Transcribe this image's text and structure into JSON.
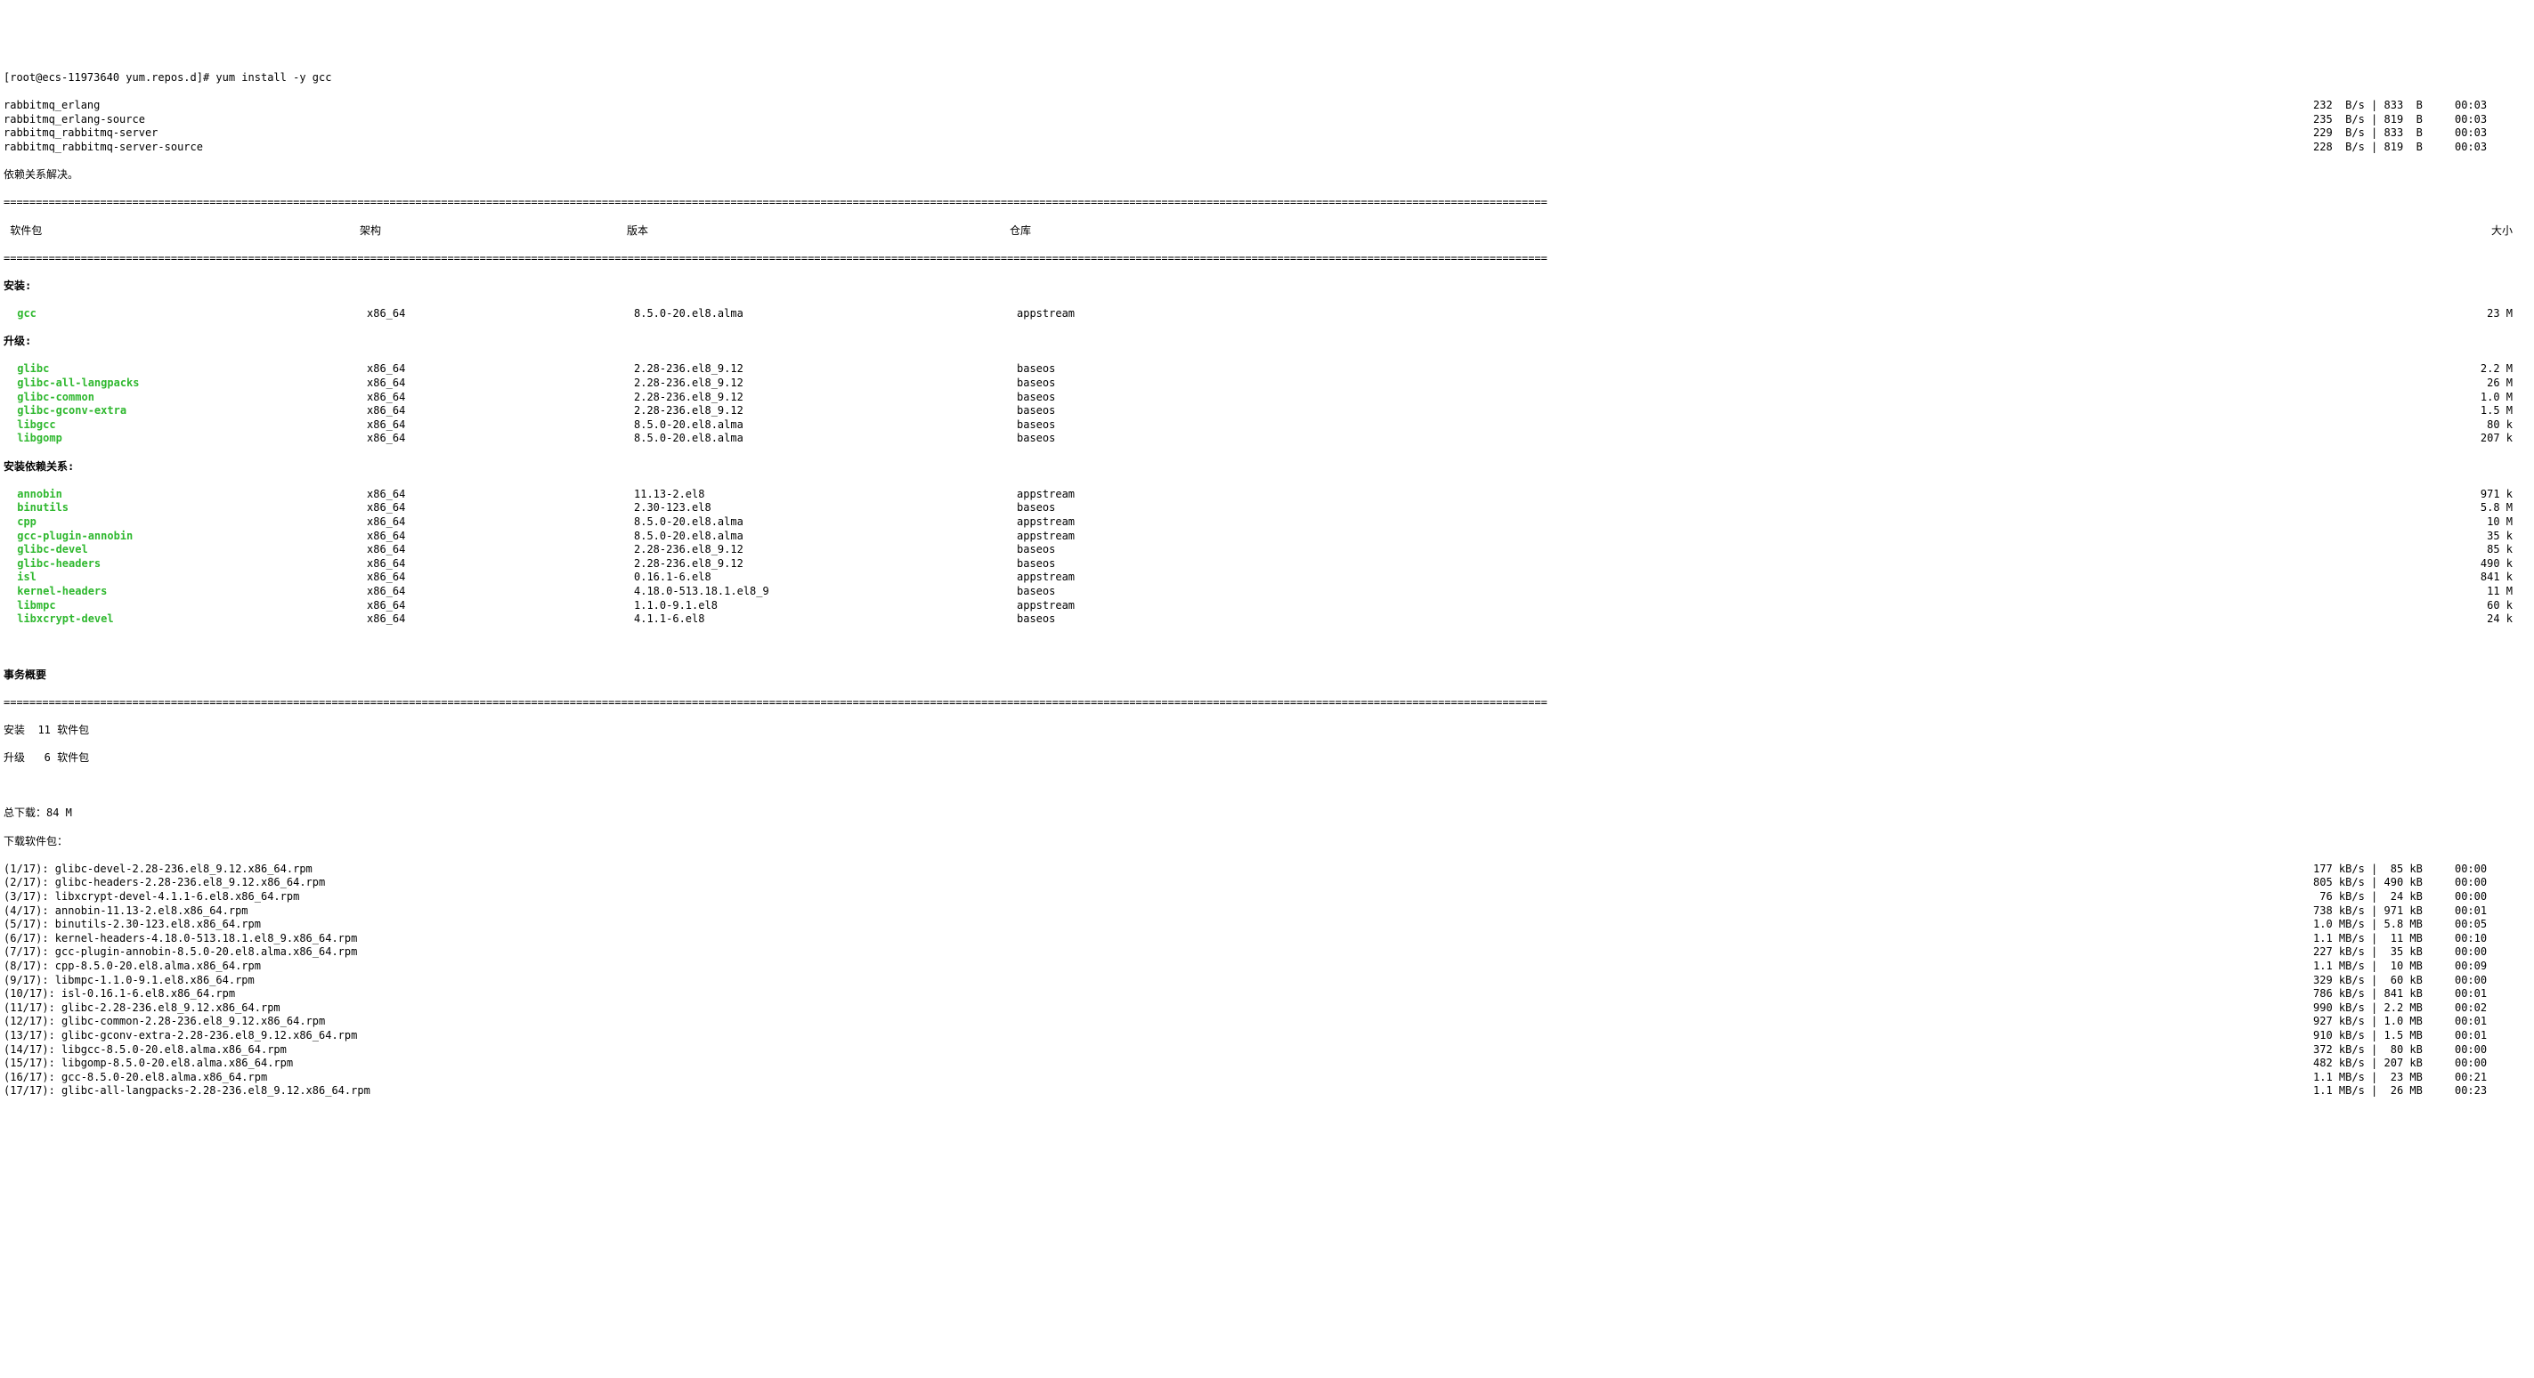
{
  "prompt": "[root@ecs-11973640 yum.repos.d]# yum install -y gcc",
  "repos": [
    {
      "name": "rabbitmq_erlang",
      "speed": "232  B/s",
      "size": "833  B",
      "time": "00:03"
    },
    {
      "name": "rabbitmq_erlang-source",
      "speed": "235  B/s",
      "size": "819  B",
      "time": "00:03"
    },
    {
      "name": "rabbitmq_rabbitmq-server",
      "speed": "229  B/s",
      "size": "833  B",
      "time": "00:03"
    },
    {
      "name": "rabbitmq_rabbitmq-server-source",
      "speed": "228  B/s",
      "size": "819  B",
      "time": "00:03"
    }
  ],
  "deps_resolved": "依赖关系解决。",
  "headers": {
    "pkg": " 软件包",
    "arch": "架构",
    "ver": "版本",
    "repo": "仓库",
    "size": "大小"
  },
  "sections": {
    "install": "安装:",
    "upgrade": "升级:",
    "install_deps": "安装依赖关系:"
  },
  "install": [
    {
      "name": "gcc",
      "arch": "x86_64",
      "ver": "8.5.0-20.el8.alma",
      "repo": "appstream",
      "size": "23 M"
    }
  ],
  "upgrade": [
    {
      "name": "glibc",
      "arch": "x86_64",
      "ver": "2.28-236.el8_9.12",
      "repo": "baseos",
      "size": "2.2 M"
    },
    {
      "name": "glibc-all-langpacks",
      "arch": "x86_64",
      "ver": "2.28-236.el8_9.12",
      "repo": "baseos",
      "size": "26 M"
    },
    {
      "name": "glibc-common",
      "arch": "x86_64",
      "ver": "2.28-236.el8_9.12",
      "repo": "baseos",
      "size": "1.0 M"
    },
    {
      "name": "glibc-gconv-extra",
      "arch": "x86_64",
      "ver": "2.28-236.el8_9.12",
      "repo": "baseos",
      "size": "1.5 M"
    },
    {
      "name": "libgcc",
      "arch": "x86_64",
      "ver": "8.5.0-20.el8.alma",
      "repo": "baseos",
      "size": "80 k"
    },
    {
      "name": "libgomp",
      "arch": "x86_64",
      "ver": "8.5.0-20.el8.alma",
      "repo": "baseos",
      "size": "207 k"
    }
  ],
  "install_deps": [
    {
      "name": "annobin",
      "arch": "x86_64",
      "ver": "11.13-2.el8",
      "repo": "appstream",
      "size": "971 k"
    },
    {
      "name": "binutils",
      "arch": "x86_64",
      "ver": "2.30-123.el8",
      "repo": "baseos",
      "size": "5.8 M"
    },
    {
      "name": "cpp",
      "arch": "x86_64",
      "ver": "8.5.0-20.el8.alma",
      "repo": "appstream",
      "size": "10 M"
    },
    {
      "name": "gcc-plugin-annobin",
      "arch": "x86_64",
      "ver": "8.5.0-20.el8.alma",
      "repo": "appstream",
      "size": "35 k"
    },
    {
      "name": "glibc-devel",
      "arch": "x86_64",
      "ver": "2.28-236.el8_9.12",
      "repo": "baseos",
      "size": "85 k"
    },
    {
      "name": "glibc-headers",
      "arch": "x86_64",
      "ver": "2.28-236.el8_9.12",
      "repo": "baseos",
      "size": "490 k"
    },
    {
      "name": "isl",
      "arch": "x86_64",
      "ver": "0.16.1-6.el8",
      "repo": "appstream",
      "size": "841 k"
    },
    {
      "name": "kernel-headers",
      "arch": "x86_64",
      "ver": "4.18.0-513.18.1.el8_9",
      "repo": "baseos",
      "size": "11 M"
    },
    {
      "name": "libmpc",
      "arch": "x86_64",
      "ver": "1.1.0-9.1.el8",
      "repo": "appstream",
      "size": "60 k"
    },
    {
      "name": "libxcrypt-devel",
      "arch": "x86_64",
      "ver": "4.1.1-6.el8",
      "repo": "baseos",
      "size": "24 k"
    }
  ],
  "summary": {
    "title": "事务概要",
    "install": "安装  11 软件包",
    "upgrade": "升级   6 软件包",
    "total": "总下载：84 M",
    "downloading": "下载软件包："
  },
  "downloads": [
    {
      "name": "(1/17): glibc-devel-2.28-236.el8_9.12.x86_64.rpm",
      "speed": "177 kB/s",
      "size": " 85 kB",
      "time": "00:00"
    },
    {
      "name": "(2/17): glibc-headers-2.28-236.el8_9.12.x86_64.rpm",
      "speed": "805 kB/s",
      "size": "490 kB",
      "time": "00:00"
    },
    {
      "name": "(3/17): libxcrypt-devel-4.1.1-6.el8.x86_64.rpm",
      "speed": " 76 kB/s",
      "size": " 24 kB",
      "time": "00:00"
    },
    {
      "name": "(4/17): annobin-11.13-2.el8.x86_64.rpm",
      "speed": "738 kB/s",
      "size": "971 kB",
      "time": "00:01"
    },
    {
      "name": "(5/17): binutils-2.30-123.el8.x86_64.rpm",
      "speed": "1.0 MB/s",
      "size": "5.8 MB",
      "time": "00:05"
    },
    {
      "name": "(6/17): kernel-headers-4.18.0-513.18.1.el8_9.x86_64.rpm",
      "speed": "1.1 MB/s",
      "size": " 11 MB",
      "time": "00:10"
    },
    {
      "name": "(7/17): gcc-plugin-annobin-8.5.0-20.el8.alma.x86_64.rpm",
      "speed": "227 kB/s",
      "size": " 35 kB",
      "time": "00:00"
    },
    {
      "name": "(8/17): cpp-8.5.0-20.el8.alma.x86_64.rpm",
      "speed": "1.1 MB/s",
      "size": " 10 MB",
      "time": "00:09"
    },
    {
      "name": "(9/17): libmpc-1.1.0-9.1.el8.x86_64.rpm",
      "speed": "329 kB/s",
      "size": " 60 kB",
      "time": "00:00"
    },
    {
      "name": "(10/17): isl-0.16.1-6.el8.x86_64.rpm",
      "speed": "786 kB/s",
      "size": "841 kB",
      "time": "00:01"
    },
    {
      "name": "(11/17): glibc-2.28-236.el8_9.12.x86_64.rpm",
      "speed": "990 kB/s",
      "size": "2.2 MB",
      "time": "00:02"
    },
    {
      "name": "(12/17): glibc-common-2.28-236.el8_9.12.x86_64.rpm",
      "speed": "927 kB/s",
      "size": "1.0 MB",
      "time": "00:01"
    },
    {
      "name": "(13/17): glibc-gconv-extra-2.28-236.el8_9.12.x86_64.rpm",
      "speed": "910 kB/s",
      "size": "1.5 MB",
      "time": "00:01"
    },
    {
      "name": "(14/17): libgcc-8.5.0-20.el8.alma.x86_64.rpm",
      "speed": "372 kB/s",
      "size": " 80 kB",
      "time": "00:00"
    },
    {
      "name": "(15/17): libgomp-8.5.0-20.el8.alma.x86_64.rpm",
      "speed": "482 kB/s",
      "size": "207 kB",
      "time": "00:00"
    },
    {
      "name": "(16/17): gcc-8.5.0-20.el8.alma.x86_64.rpm",
      "speed": "1.1 MB/s",
      "size": " 23 MB",
      "time": "00:21"
    },
    {
      "name": "(17/17): glibc-all-langpacks-2.28-236.el8_9.12.x86_64.rpm",
      "speed": "1.1 MB/s",
      "size": " 26 MB",
      "time": "00:23"
    }
  ]
}
